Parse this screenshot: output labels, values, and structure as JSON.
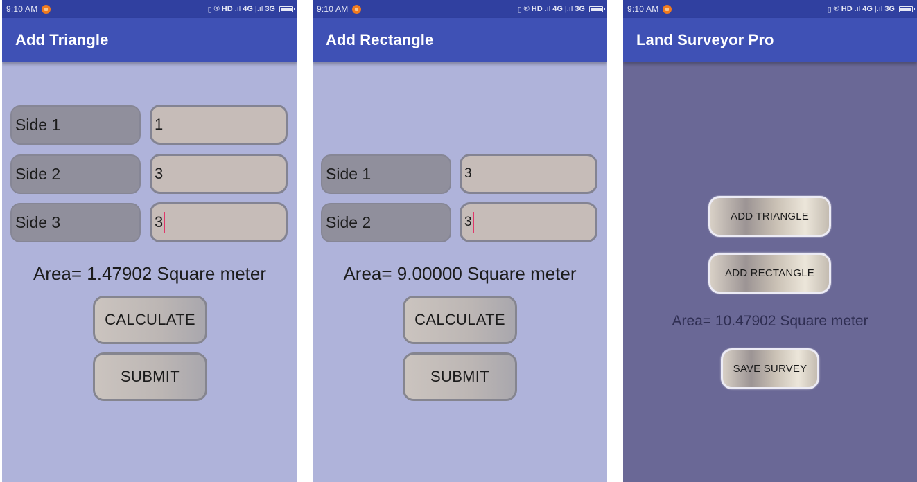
{
  "status_bar": {
    "time": "9:10 AM",
    "indicators": [
      "vibrate-icon",
      "roaming-icon"
    ],
    "network_text_1": "HD",
    "network_text_2": "4G",
    "network_text_3": "3G",
    "battery": "battery-full-icon"
  },
  "screens": [
    {
      "title": "Add Triangle",
      "fields": [
        {
          "label": "Side 1",
          "value": "1"
        },
        {
          "label": "Side 2",
          "value": "3"
        },
        {
          "label": "Side 3",
          "value": "3"
        }
      ],
      "area_text": "Area= 1.47902 Square meter",
      "buttons": {
        "calculate": "CALCULATE",
        "submit": "SUBMIT"
      }
    },
    {
      "title": "Add Rectangle",
      "fields": [
        {
          "label": "Side 1",
          "value": "3"
        },
        {
          "label": "Side 2",
          "value": "3"
        }
      ],
      "area_text": "Area= 9.00000 Square meter",
      "buttons": {
        "calculate": "CALCULATE",
        "submit": "SUBMIT"
      }
    },
    {
      "title": "Land Surveyor Pro",
      "buttons": {
        "add_triangle": "ADD TRIANGLE",
        "add_rectangle": "ADD RECTANGLE",
        "save_survey": "SAVE SURVEY"
      },
      "area_text": "Area= 10.47902 Square meter"
    }
  ],
  "colors": {
    "status_bar": "#3040a0",
    "app_bar": "#3f51b5",
    "form_background": "#afb3da",
    "home_background": "#6a6896",
    "caret": "#e0386a"
  }
}
